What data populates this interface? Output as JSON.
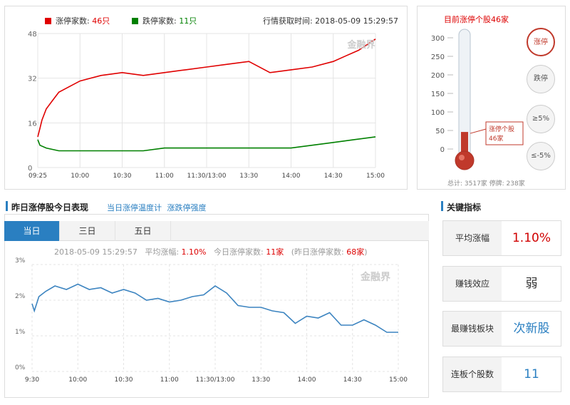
{
  "top_chart": {
    "legend_up": "涨停家数:",
    "legend_up_value": "46只",
    "legend_down": "跌停家数:",
    "legend_down_value": "11只",
    "fetch_time": "行情获取时间: 2018-05-09 15:29:57",
    "up_color": "#e00000",
    "down_color": "#008000"
  },
  "thermometer": {
    "title": "目前涨停个股46家",
    "ticks": [
      "300",
      "250",
      "200",
      "150",
      "100",
      "50",
      "0"
    ],
    "callout_line1": "涨停个股",
    "callout_line2": "46家",
    "footer": "总计: 3517家  停牌: 238家",
    "buttons": [
      "涨停",
      "跌停",
      "≥5%",
      "≤-5%"
    ],
    "level": 46,
    "max": 300
  },
  "section": {
    "title": "昨日涨停股今日表现",
    "link1": "当日涨停温度计",
    "link2": "涨跌停强度",
    "key_title": "关键指标"
  },
  "tabs": [
    "当日",
    "三日",
    "五日"
  ],
  "info": {
    "date": "2018-05-09 15:29:57",
    "avg_label": "平均涨幅:",
    "avg_value": "1.10%",
    "today_label": "今日涨停家数:",
    "today_value": "11家",
    "yest_label": "(昨日涨停家数:",
    "yest_value": "68家"
  },
  "kpis": [
    {
      "label": "平均涨幅",
      "value": "1.10%",
      "color": "#d00000"
    },
    {
      "label": "赚钱效应",
      "value": "弱",
      "color": "#333333"
    },
    {
      "label": "最赚钱板块",
      "value": "次新股",
      "color": "#2a7fc1"
    },
    {
      "label": "连板个股数",
      "value": "11",
      "color": "#2a7fc1"
    }
  ],
  "watermark": "金融界",
  "chart_data": [
    {
      "type": "line",
      "ylim": [
        0,
        48
      ],
      "yticks": [
        "0",
        "16",
        "32",
        "48"
      ],
      "xticks": [
        "09:25",
        "10:00",
        "10:30",
        "11:00",
        "11:30/13:00",
        "13:30",
        "14:00",
        "14:30",
        "15:00"
      ],
      "grid": true,
      "series": [
        {
          "name": "涨停家数",
          "color": "#e00000",
          "x": [
            0,
            0.05,
            0.1,
            0.2,
            0.35,
            0.5,
            0.75,
            1.0,
            1.5,
            2.0,
            2.5,
            3.0,
            3.5,
            4.0,
            4.5,
            5.0,
            5.5,
            6.0,
            6.5,
            7.0,
            7.3,
            7.6,
            7.8,
            8.0
          ],
          "y": [
            11,
            14,
            17,
            21,
            24,
            27,
            29,
            31,
            33,
            34,
            33,
            34,
            35,
            36,
            37,
            38,
            34,
            35,
            36,
            38,
            40,
            42,
            44,
            46
          ]
        },
        {
          "name": "跌停家数",
          "color": "#008000",
          "x": [
            0,
            0.05,
            0.2,
            0.5,
            1.0,
            1.5,
            2.0,
            2.5,
            3.0,
            3.5,
            4.0,
            4.5,
            5.0,
            5.5,
            6.0,
            6.5,
            7.0,
            7.5,
            8.0
          ],
          "y": [
            10,
            8,
            7,
            6,
            6,
            6,
            6,
            6,
            7,
            7,
            7,
            7,
            7,
            7,
            7,
            8,
            9,
            10,
            11
          ]
        }
      ]
    },
    {
      "type": "line",
      "ylim": [
        0,
        3
      ],
      "yticks": [
        "0%",
        "1%",
        "2%",
        "3%"
      ],
      "xticks": [
        "9:30",
        "10:00",
        "10:30",
        "11:00",
        "11:30/13:00",
        "13:30",
        "14:00",
        "14:30",
        "15:00"
      ],
      "grid": true,
      "series": [
        {
          "name": "",
          "color": "#3c84c0",
          "x": [
            0,
            0.05,
            0.15,
            0.3,
            0.5,
            0.75,
            1.0,
            1.25,
            1.5,
            1.75,
            2.0,
            2.25,
            2.5,
            2.75,
            3.0,
            3.25,
            3.5,
            3.75,
            4.0,
            4.25,
            4.5,
            4.75,
            5.0,
            5.25,
            5.5,
            5.75,
            6.0,
            6.25,
            6.5,
            6.75,
            7.0,
            7.25,
            7.5,
            7.75,
            8.0
          ],
          "y": [
            1.9,
            1.7,
            2.1,
            2.25,
            2.4,
            2.3,
            2.45,
            2.3,
            2.35,
            2.2,
            2.3,
            2.2,
            2.0,
            2.05,
            1.95,
            2.0,
            2.1,
            2.15,
            2.4,
            2.2,
            1.85,
            1.8,
            1.8,
            1.7,
            1.65,
            1.35,
            1.55,
            1.5,
            1.65,
            1.3,
            1.3,
            1.45,
            1.3,
            1.1,
            1.1
          ]
        }
      ]
    }
  ]
}
